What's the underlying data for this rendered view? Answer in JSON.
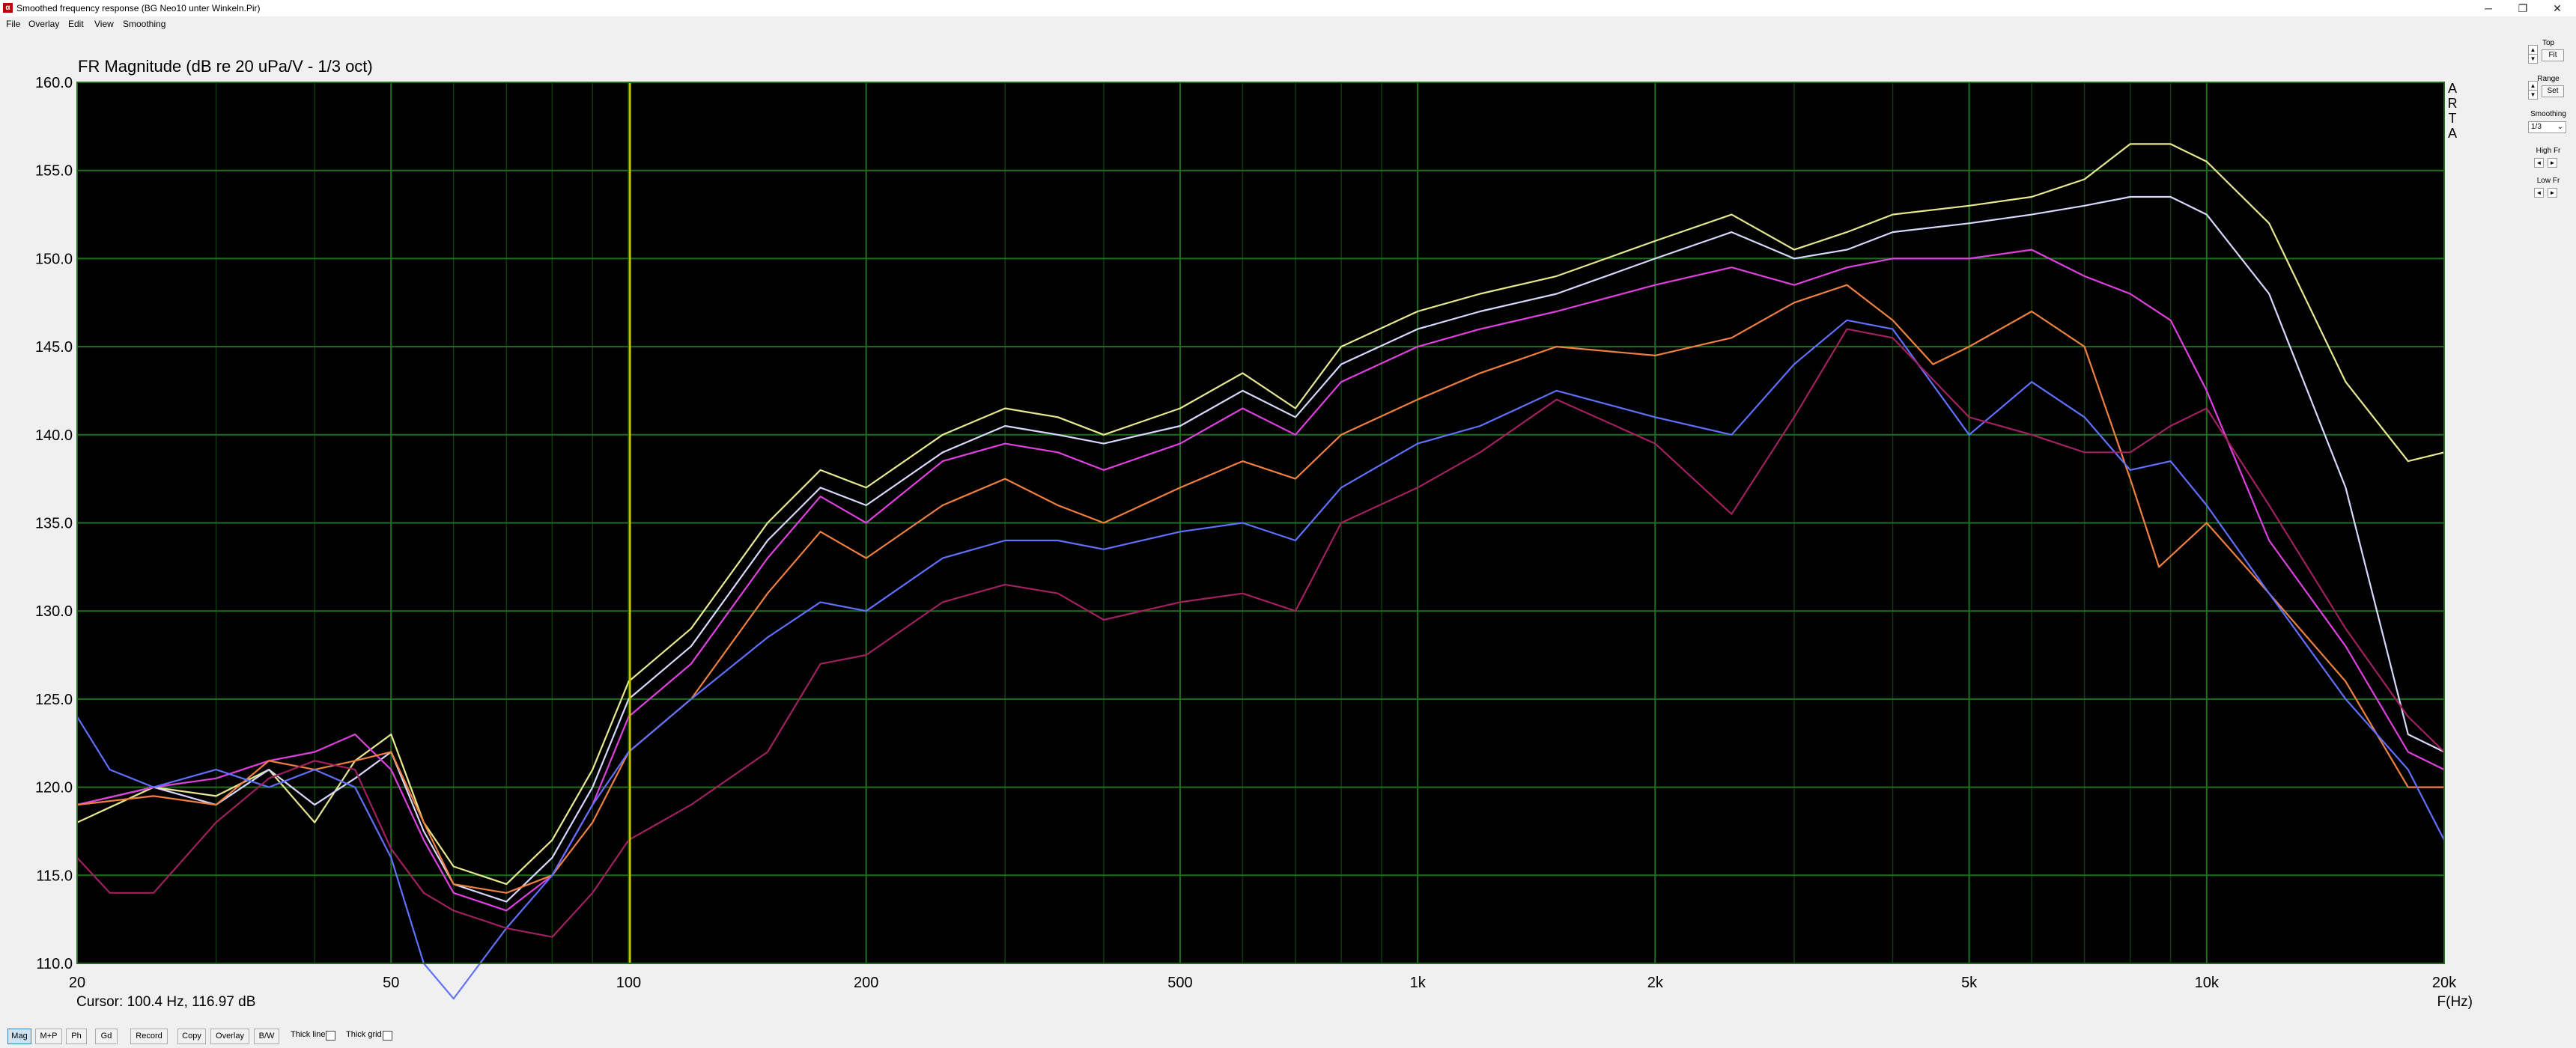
{
  "window": {
    "title": "Smoothed frequency response (BG Neo10 unter Winkeln.Pir)",
    "app_icon": "arta-app-icon",
    "minimize": "─",
    "restore": "❐",
    "close": "✕"
  },
  "menu": [
    "File",
    "Overlay",
    "Edit",
    "View",
    "Smoothing"
  ],
  "plot": {
    "title": "FR Magnitude (dB re 20 uPa/V - 1/3 oct)",
    "cursor": "Cursor: 100.4 Hz, 116.97 dB",
    "xunit": "F(Hz)",
    "brand": [
      "A",
      "R",
      "T",
      "A"
    ]
  },
  "right_panel": {
    "top_label": "Top",
    "fit_label": "Fit",
    "range_label": "Range",
    "set_label": "Set",
    "smoothing_label": "Smoothing",
    "smoothing_value": "1/3",
    "highfr_label": "High Fr",
    "lowfr_label": "Low Fr",
    "spin_up": "▲",
    "spin_down": "▼",
    "arrow_left": "◄",
    "arrow_right": "►",
    "dropdown_arrow": "⌄"
  },
  "bottom_bar": {
    "buttons": [
      "Mag",
      "M+P",
      "Ph",
      "Gd",
      "Record",
      "Copy",
      "Overlay",
      "B/W"
    ],
    "active": "Mag",
    "thick_line": "Thick line",
    "thick_grid": "Thick grid"
  },
  "colors": {
    "plot_bg": "#000000",
    "grid": "#1f6f1f",
    "grid_minor": "#0f3a0f",
    "cursor_line": "#c8c800"
  },
  "chart_data": {
    "type": "line",
    "title": "FR Magnitude (dB re 20 uPa/V - 1/3 oct)",
    "xlabel": "F(Hz)",
    "ylabel": "",
    "xscale": "log",
    "xlim": [
      20,
      20000
    ],
    "ylim": [
      110,
      160
    ],
    "grid": true,
    "x_ticks": [
      20,
      50,
      100,
      200,
      500,
      1000,
      2000,
      5000,
      10000,
      20000
    ],
    "x_tick_labels": [
      "20",
      "50",
      "100",
      "200",
      "500",
      "1k",
      "2k",
      "5k",
      "10k",
      "20k"
    ],
    "y_ticks": [
      110,
      115,
      120,
      125,
      130,
      135,
      140,
      145,
      150,
      155,
      160
    ],
    "y_tick_labels": [
      "110.0",
      "115.0",
      "120.0",
      "125.0",
      "130.0",
      "135.0",
      "140.0",
      "145.0",
      "150.0",
      "155.0",
      "160.0"
    ],
    "cursor": {
      "x": 100.4,
      "y": 116.97
    },
    "series": [
      {
        "color": "#e8e890",
        "x": [
          20,
          25,
          30,
          35,
          40,
          45,
          50,
          55,
          60,
          70,
          80,
          90,
          100,
          120,
          150,
          175,
          200,
          250,
          300,
          350,
          400,
          500,
          600,
          700,
          800,
          1000,
          1200,
          1500,
          2000,
          2500,
          3000,
          3500,
          4000,
          5000,
          6000,
          7000,
          8000,
          9000,
          10000,
          12000,
          15000,
          18000,
          20000
        ],
        "y": [
          118,
          120,
          119.5,
          121,
          118,
          121.5,
          123,
          118,
          115.5,
          114.5,
          117,
          121,
          126,
          129,
          135,
          138,
          137,
          140,
          141.5,
          141,
          140,
          141.5,
          143.5,
          141.5,
          145,
          147,
          148,
          149,
          151,
          152.5,
          150.5,
          151.5,
          152.5,
          153,
          153.5,
          154.5,
          156.5,
          156.5,
          155.5,
          152,
          143,
          138.5,
          139
        ]
      },
      {
        "color": "#d8d8ff",
        "x": [
          20,
          25,
          30,
          35,
          40,
          45,
          50,
          55,
          60,
          70,
          80,
          90,
          100,
          120,
          150,
          175,
          200,
          250,
          300,
          350,
          400,
          500,
          600,
          700,
          800,
          1000,
          1200,
          1500,
          2000,
          2500,
          3000,
          3500,
          4000,
          5000,
          6000,
          7000,
          8000,
          9000,
          10000,
          12000,
          15000,
          18000,
          20000
        ],
        "y": [
          119,
          120,
          119,
          121,
          119,
          120.5,
          122,
          117.5,
          114.5,
          113.5,
          116,
          120,
          125,
          128,
          134,
          137,
          136,
          139,
          140.5,
          140,
          139.5,
          140.5,
          142.5,
          141,
          144,
          146,
          147,
          148,
          150,
          151.5,
          150,
          150.5,
          151.5,
          152,
          152.5,
          153,
          153.5,
          153.5,
          152.5,
          148,
          137,
          123,
          122
        ]
      },
      {
        "color": "#e040e0",
        "x": [
          20,
          25,
          30,
          35,
          40,
          45,
          50,
          55,
          60,
          70,
          80,
          90,
          100,
          120,
          150,
          175,
          200,
          250,
          300,
          350,
          400,
          500,
          600,
          700,
          800,
          1000,
          1200,
          1500,
          2000,
          2500,
          3000,
          3500,
          4000,
          5000,
          6000,
          7000,
          8000,
          9000,
          10000,
          12000,
          15000,
          18000,
          20000
        ],
        "y": [
          119,
          120,
          120.5,
          121.5,
          122,
          123,
          121,
          117,
          114,
          113,
          115,
          119,
          124,
          127,
          133,
          136.5,
          135,
          138.5,
          139.5,
          139,
          138,
          139.5,
          141.5,
          140,
          143,
          145,
          146,
          147,
          148.5,
          149.5,
          148.5,
          149.5,
          150,
          150,
          150.5,
          149,
          148,
          146.5,
          142.5,
          134,
          128,
          122,
          121
        ]
      },
      {
        "color": "#f08040",
        "x": [
          20,
          25,
          30,
          35,
          40,
          45,
          50,
          55,
          60,
          70,
          80,
          90,
          100,
          120,
          150,
          175,
          200,
          250,
          300,
          350,
          400,
          500,
          600,
          700,
          800,
          1000,
          1200,
          1500,
          2000,
          2500,
          3000,
          3500,
          4000,
          4500,
          5000,
          6000,
          7000,
          8000,
          8700,
          10000,
          12000,
          15000,
          18000,
          20000
        ],
        "y": [
          119,
          119.5,
          119,
          121.5,
          121,
          121.5,
          122,
          118,
          114.5,
          114,
          115,
          118,
          122,
          125,
          131,
          134.5,
          133,
          136,
          137.5,
          136,
          135,
          137,
          138.5,
          137.5,
          140,
          142,
          143.5,
          145,
          144.5,
          145.5,
          147.5,
          148.5,
          146.5,
          144,
          145,
          147,
          145,
          137.5,
          132.5,
          135,
          131,
          126,
          120,
          120
        ]
      },
      {
        "color": "#6070ff",
        "x": [
          20,
          22,
          25,
          30,
          35,
          40,
          45,
          50,
          55,
          60,
          70,
          80,
          90,
          100,
          120,
          150,
          175,
          200,
          250,
          300,
          350,
          400,
          500,
          600,
          700,
          800,
          1000,
          1200,
          1500,
          2000,
          2500,
          3000,
          3500,
          4000,
          5000,
          6000,
          7000,
          8000,
          9000,
          10000,
          12000,
          15000,
          18000,
          20000
        ],
        "y": [
          124,
          121,
          120,
          121,
          120,
          121,
          120,
          116,
          110,
          108,
          112,
          115,
          119,
          122,
          125,
          128.5,
          130.5,
          130,
          133,
          134,
          134,
          133.5,
          134.5,
          135,
          134,
          137,
          139.5,
          140.5,
          142.5,
          141,
          140,
          144,
          146.5,
          146,
          140,
          143,
          141,
          138,
          138.5,
          136,
          131,
          125,
          121,
          117
        ]
      },
      {
        "color": "#a02060",
        "x": [
          20,
          22,
          25,
          30,
          35,
          40,
          45,
          50,
          55,
          60,
          70,
          80,
          90,
          100,
          120,
          150,
          175,
          200,
          250,
          300,
          350,
          400,
          500,
          600,
          700,
          800,
          1000,
          1200,
          1500,
          2000,
          2500,
          3000,
          3500,
          4000,
          5000,
          6000,
          7000,
          8000,
          9000,
          10000,
          12000,
          15000,
          18000,
          20000
        ],
        "y": [
          116,
          114,
          114,
          118,
          120.5,
          121.5,
          121,
          116.5,
          114,
          113,
          112,
          111.5,
          114,
          117,
          119,
          122,
          127,
          127.5,
          130.5,
          131.5,
          131,
          129.5,
          130.5,
          131,
          130,
          135,
          137,
          139,
          142,
          139.5,
          135.5,
          141,
          146,
          145.5,
          141,
          140,
          139,
          139,
          140.5,
          141.5,
          136,
          129,
          124,
          122
        ]
      }
    ]
  }
}
